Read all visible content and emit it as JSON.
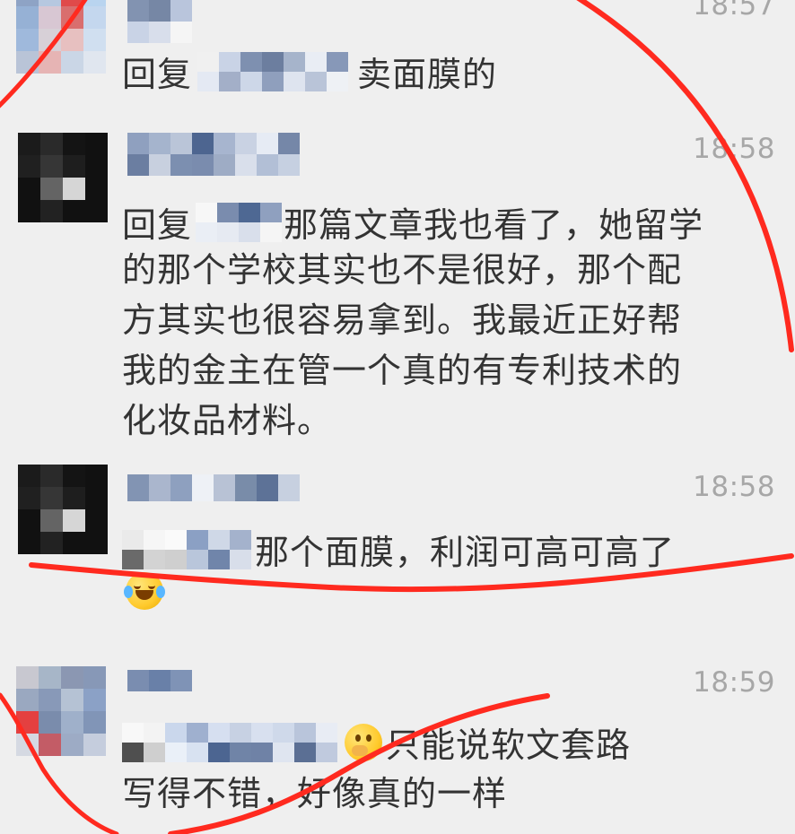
{
  "app": {
    "background": "#efefef",
    "annotation_color": "#ff2a1f"
  },
  "messages": [
    {
      "time": "18:57",
      "text": "卖面膜的",
      "prefix": "回复"
    },
    {
      "time": "18:58",
      "lines": [
        "回复",
        "那篇文章我也看了，她留学",
        "的那个学校其实也不是很好，那个配",
        "方其实也很容易拿到。我最近正好帮",
        "我的金主在管一个真的有专利技术的",
        "化妆品材料。"
      ]
    },
    {
      "time": "18:58",
      "text": "那个面膜，利润可高可高了",
      "emoji": "laughing-tears-icon"
    },
    {
      "time": "18:59",
      "lines": [
        "只能说软文套路",
        "写得不错，好像真的一样"
      ],
      "emoji": "thinking-face-icon"
    }
  ]
}
